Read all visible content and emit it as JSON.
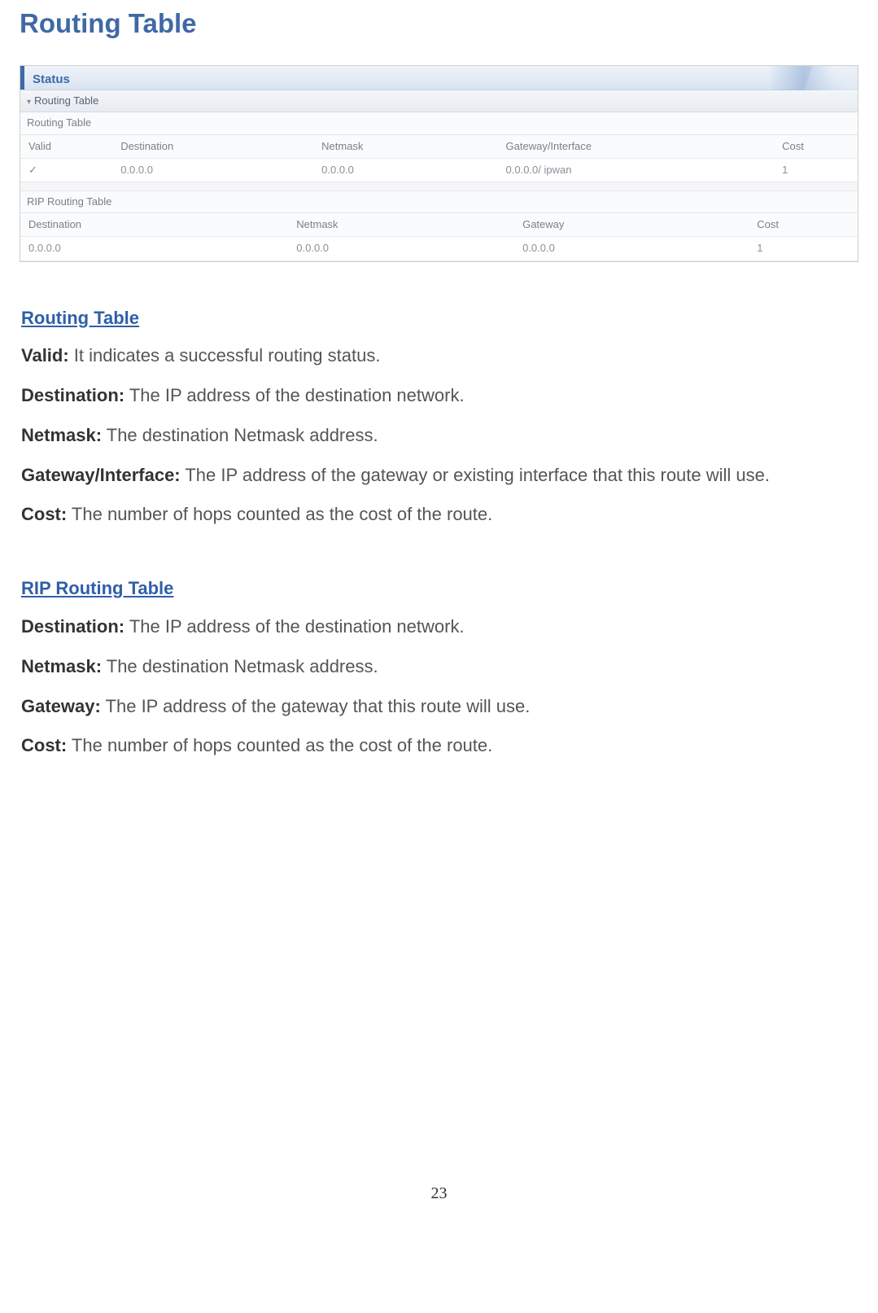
{
  "page_title": "Routing Table",
  "screenshot": {
    "status_label": "Status",
    "section_main": "Routing Table",
    "routing_table": {
      "title": "Routing Table",
      "headers": [
        "Valid",
        "Destination",
        "Netmask",
        "Gateway/Interface",
        "Cost"
      ],
      "row": {
        "valid_icon": "✓",
        "destination": "0.0.0.0",
        "netmask": "0.0.0.0",
        "gateway": "0.0.0.0/ ipwan",
        "cost": "1"
      }
    },
    "rip_table": {
      "title": "RIP Routing Table",
      "headers": [
        "Destination",
        "Netmask",
        "Gateway",
        "Cost"
      ],
      "row": {
        "destination": "0.0.0.0",
        "netmask": "0.0.0.0",
        "gateway": "0.0.0.0",
        "cost": "1"
      }
    }
  },
  "doc": {
    "routing_heading": "Routing Table",
    "routing": [
      {
        "term": "Valid:",
        "desc": "  It indicates a successful routing status."
      },
      {
        "term": "Destination:",
        "desc": " The IP address of the destination network."
      },
      {
        "term": "Netmask:",
        "desc": " The destination Netmask address."
      },
      {
        "term": "Gateway/Interface:",
        "desc": " The IP address of the gateway or existing interface that this route will use."
      },
      {
        "term": "Cost:",
        "desc": " The number of hops counted as the cost of the route."
      }
    ],
    "rip_heading": "RIP Routing Table",
    "rip": [
      {
        "term": "Destination:",
        "desc": " The IP address of the destination network."
      },
      {
        "term": "Netmask:",
        "desc": " The destination Netmask address."
      },
      {
        "term": "Gateway:",
        "desc": " The IP address of the gateway that this route will use."
      },
      {
        "term": "Cost:",
        "desc": " The number of hops counted as the cost of the route."
      }
    ]
  },
  "page_number": "23"
}
